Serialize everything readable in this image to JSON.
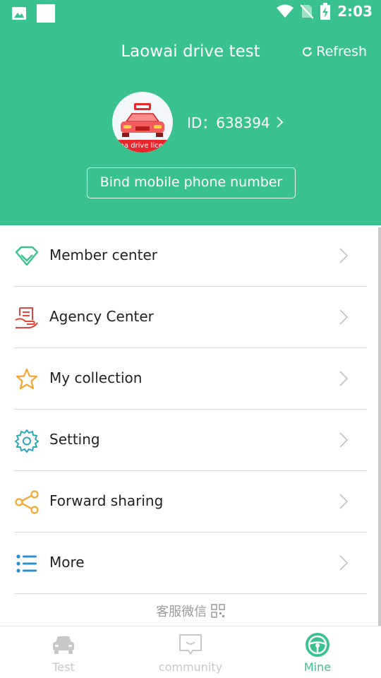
{
  "status_bar": {
    "time": "2:03"
  },
  "header": {
    "title": "Laowai drive test",
    "refresh_label": "Refresh",
    "avatar_text": "ina drive licen",
    "id_text": "ID：638394",
    "bind_button": "Bind mobile phone number"
  },
  "menu": {
    "items": [
      {
        "label": "Member center",
        "icon": "diamond-icon",
        "color": "#3cc48f"
      },
      {
        "label": "Agency Center",
        "icon": "agency-hand-icon",
        "color": "#e0443a"
      },
      {
        "label": "My collection",
        "icon": "star-icon",
        "color": "#f3a732"
      },
      {
        "label": "Setting",
        "icon": "gear-icon",
        "color": "#2aa6b8"
      },
      {
        "label": "Forward sharing",
        "icon": "share-icon",
        "color": "#f3a732"
      },
      {
        "label": "More",
        "icon": "list-icon",
        "color": "#2d8fd0"
      }
    ]
  },
  "wechat_service": "客服微信",
  "tabbar": {
    "tabs": [
      {
        "label": "Test",
        "icon": "car-icon",
        "active": false
      },
      {
        "label": "community",
        "icon": "chat-icon",
        "active": false
      },
      {
        "label": "Mine",
        "icon": "steering-wheel-icon",
        "active": true
      }
    ],
    "active_color": "#39c28f",
    "inactive_color": "#c8c8c8"
  },
  "colors": {
    "brand_green": "#39c28f",
    "divider": "#dcdcdc"
  }
}
